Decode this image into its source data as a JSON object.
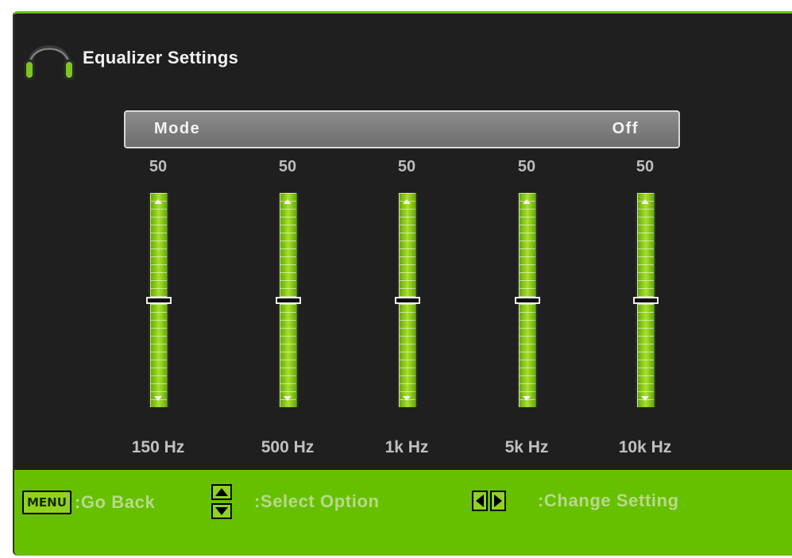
{
  "header": {
    "title": "Equalizer Settings",
    "icon": "headphones-icon"
  },
  "mode": {
    "label": "Mode",
    "value": "Off"
  },
  "bands": [
    {
      "label": "150 Hz",
      "value": "50",
      "level": 0.5
    },
    {
      "label": "500 Hz",
      "value": "50",
      "level": 0.5
    },
    {
      "label": "1k Hz",
      "value": "50",
      "level": 0.5
    },
    {
      "label": "5k Hz",
      "value": "50",
      "level": 0.5
    },
    {
      "label": "10k Hz",
      "value": "50",
      "level": 0.5
    }
  ],
  "footer": {
    "menu_key": "MENU",
    "back_hint": ":Go Back",
    "select_hint": ":Select Option",
    "change_hint": ":Change Setting"
  },
  "colors": {
    "accent": "#66c000",
    "background": "#1f1f1f",
    "slider": "#a8e12a"
  }
}
